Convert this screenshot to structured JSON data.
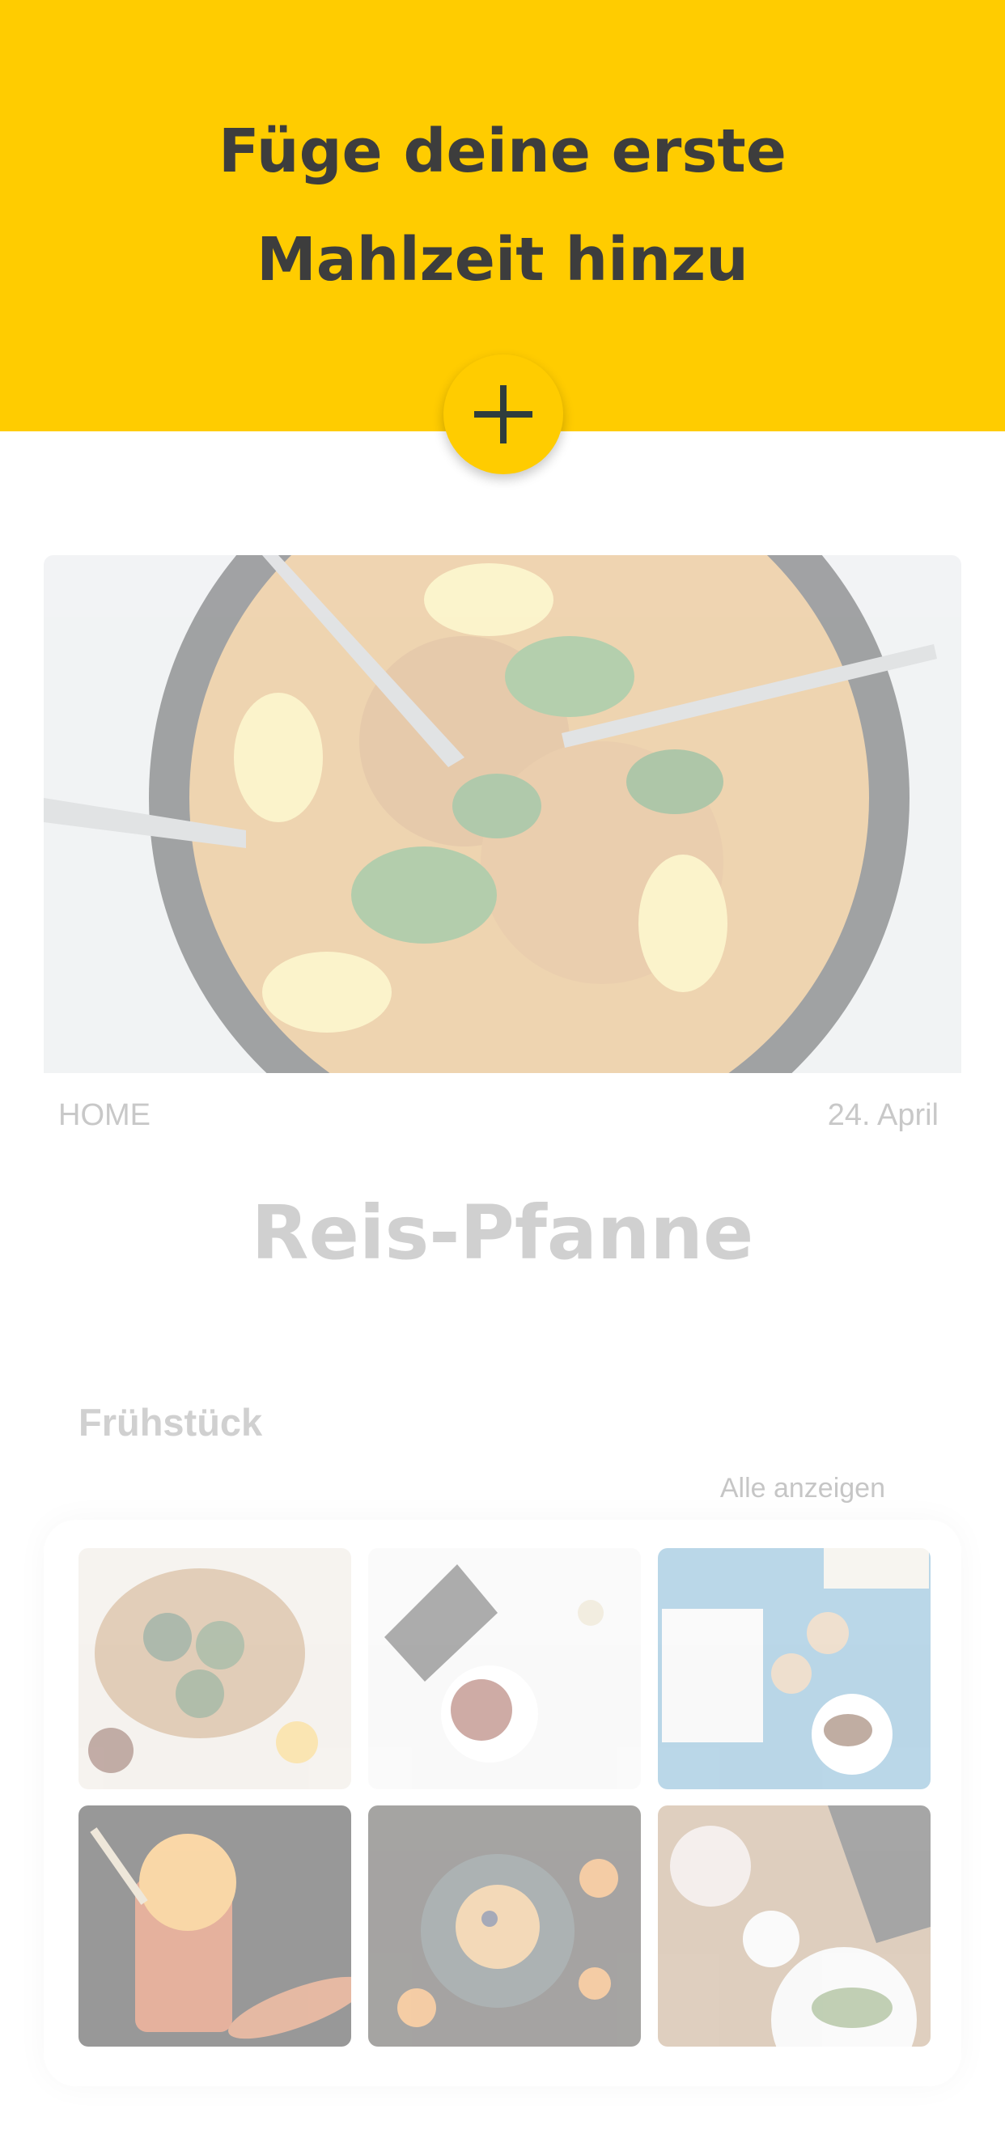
{
  "header": {
    "title_line1": "Füge deine erste",
    "title_line2": "Mahlzeit hinzu",
    "background": "#FFCC00",
    "add_icon": "plus-icon"
  },
  "featured": {
    "label": "HOME",
    "date": "24. April",
    "title": "Reis-Pfanne",
    "image": "paella-pan-photo"
  },
  "breakfast": {
    "title": "Frühstück",
    "show_all": "Alle anzeigen",
    "thumbnails": [
      "bowls-on-wood-photo",
      "pancakes-plate-photo",
      "books-coffee-croissants-photo",
      "orange-juice-glass-photo",
      "pancake-stack-photo",
      "tea-toast-table-photo"
    ]
  }
}
